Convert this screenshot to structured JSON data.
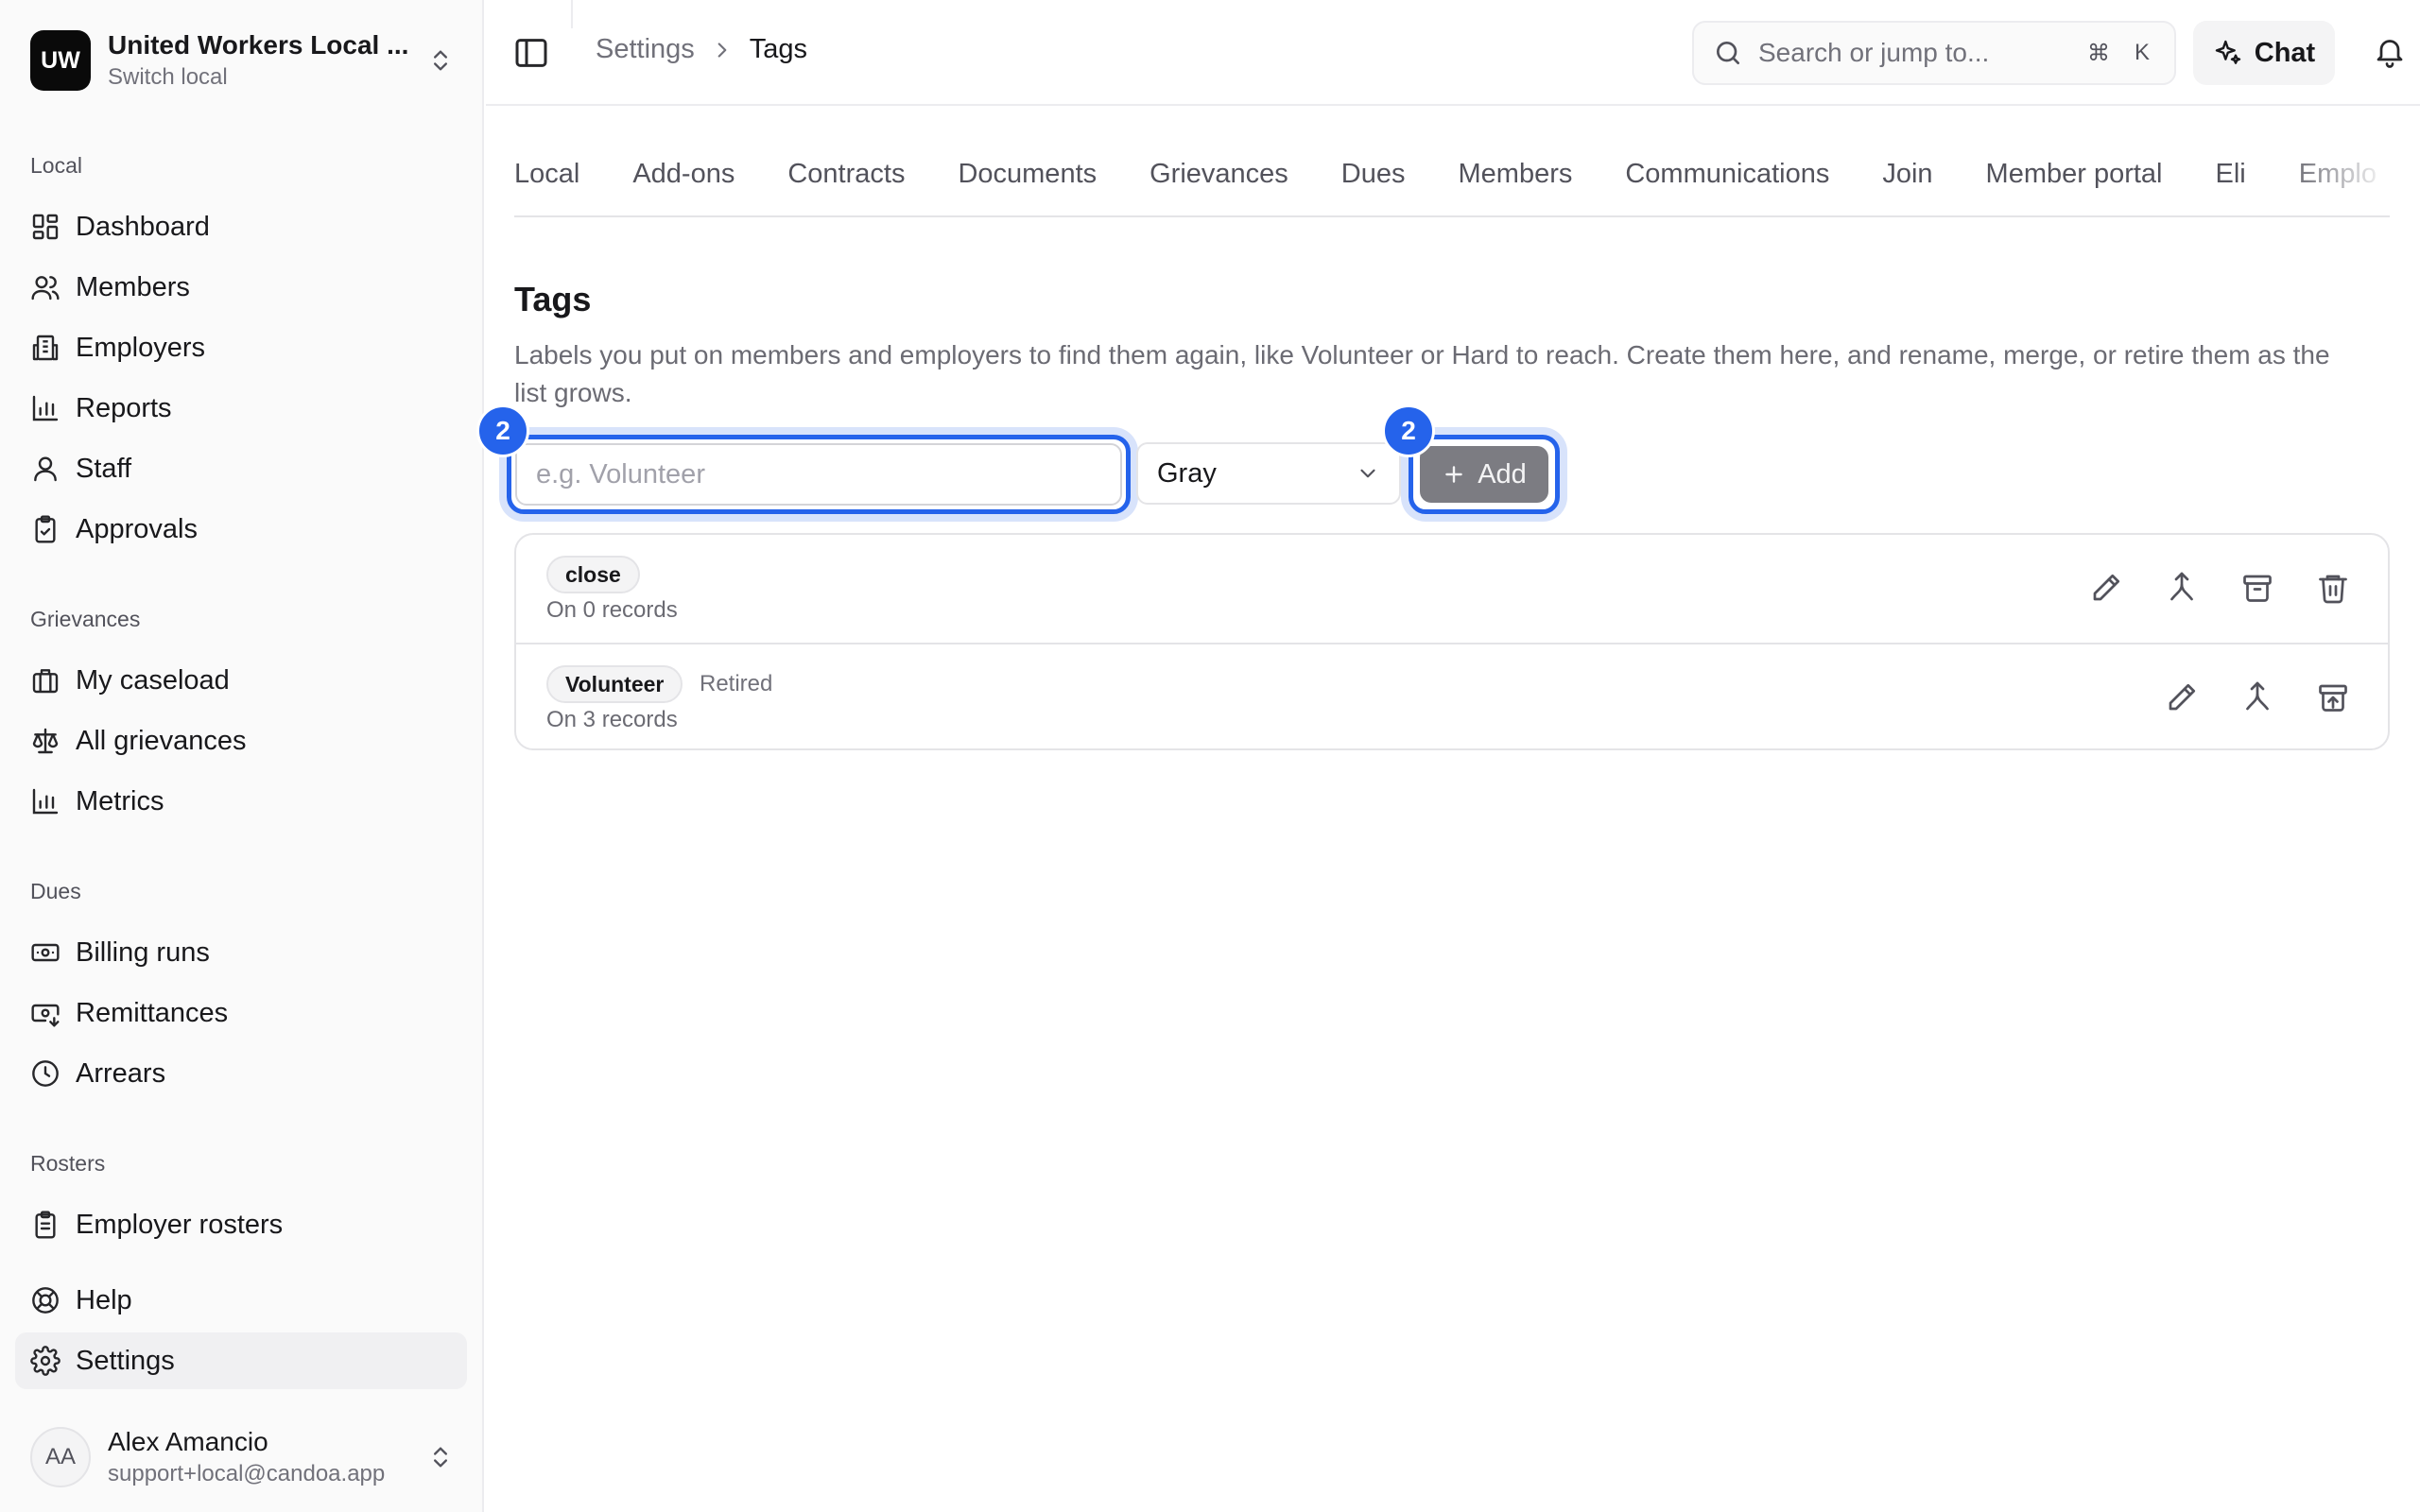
{
  "org": {
    "logo": "UW",
    "name": "United Workers Local ...",
    "subtitle": "Switch local"
  },
  "sidebar": {
    "groups": [
      {
        "label": "Local"
      },
      {
        "label": "Grievances"
      },
      {
        "label": "Dues"
      },
      {
        "label": "Rosters"
      }
    ],
    "items": {
      "dashboard": "Dashboard",
      "members": "Members",
      "employers": "Employers",
      "reports": "Reports",
      "staff": "Staff",
      "approvals": "Approvals",
      "my_caseload": "My caseload",
      "all_grievances": "All grievances",
      "metrics": "Metrics",
      "billing_runs": "Billing runs",
      "remittances": "Remittances",
      "arrears": "Arrears",
      "employer_rosters": "Employer rosters",
      "help": "Help",
      "settings": "Settings"
    },
    "active": "settings"
  },
  "user": {
    "initials": "AA",
    "name": "Alex Amancio",
    "email": "support+local@candoa.app"
  },
  "header": {
    "breadcrumb": [
      "Settings",
      "Tags"
    ],
    "search_placeholder": "Search or jump to...",
    "shortcut": [
      "⌘",
      "K"
    ],
    "chat_label": "Chat"
  },
  "tabs": [
    "Local",
    "Add-ons",
    "Contracts",
    "Documents",
    "Grievances",
    "Dues",
    "Members",
    "Communications",
    "Join",
    "Member portal",
    "Eli",
    "Emplo"
  ],
  "page": {
    "title": "Tags",
    "description": "Labels you put on members and employers to find them again, like Volunteer or Hard to reach. Create them here, and rename, merge, or retire them as the list grows."
  },
  "form": {
    "name_value": "",
    "name_placeholder": "e.g. Volunteer",
    "color_value": "Gray",
    "add_label": "Add",
    "annotation_input": "2",
    "annotation_add": "2"
  },
  "tags": [
    {
      "name": "close",
      "status": "",
      "records": "On 0 records"
    },
    {
      "name": "Volunteer",
      "status": "Retired",
      "records": "On 3 records"
    }
  ],
  "colors": {
    "accent": "#2563eb",
    "add_button": "#7c7c82",
    "sidebar_bg": "#fafafa"
  }
}
